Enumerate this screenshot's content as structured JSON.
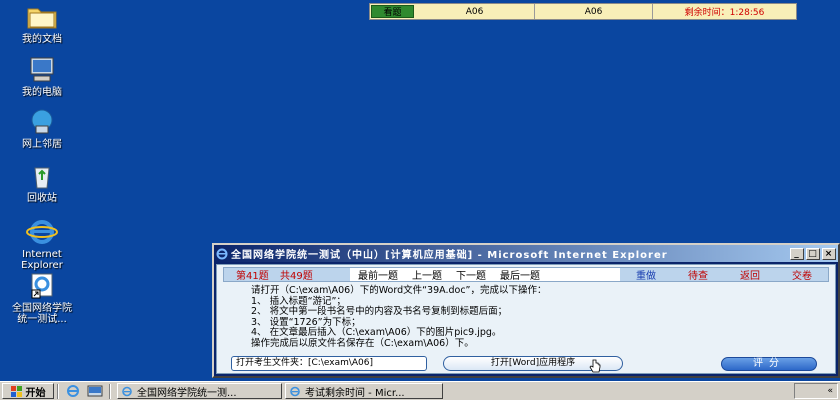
{
  "desktop": {
    "icons": [
      {
        "label": "我的文档",
        "icon": "folder-icon"
      },
      {
        "label": "我的电脑",
        "icon": "computer-icon"
      },
      {
        "label": "网上邻居",
        "icon": "network-icon"
      },
      {
        "label": "回收站",
        "icon": "recycle-bin-icon"
      },
      {
        "label": "Internet\nExplorer",
        "icon": "ie-icon"
      },
      {
        "label": "全国网络学院\n统一测试...",
        "icon": "shortcut-icon"
      }
    ]
  },
  "exam_bar": {
    "view_label": "看题",
    "field1": "A06",
    "field2": "A06",
    "timer": "剩余时间：1:28:56"
  },
  "window": {
    "title": "全国网络学院统一测试（中山）[计算机应用基础] - Microsoft Internet Explorer",
    "title_buttons": [
      "_",
      "□",
      "×"
    ],
    "nav": {
      "question_no": "第41题",
      "question_total": "共49题",
      "first": "最前一题",
      "prev": "上一题",
      "next": "下一题",
      "last": "最后一题",
      "redo": "重做",
      "pending": "待查",
      "back": "返回",
      "submit": "交卷"
    },
    "task_lines": [
      "请打开（C:\\exam\\A06）下的Word文件“39A.doc”，完成以下操作：",
      "1、 插入标题“游记”；",
      "2、 将文中第一段书名号中的内容及书名号复制到标题后面；",
      "3、 设置“1726”为下标；",
      "4、 在文章最后插入（C:\\exam\\A06）下的图片pic9.jpg。",
      "操作完成后以原文件名保存在（C:\\exam\\A06）下。"
    ],
    "open_folder_label": "打开考生文件夹：[C:\\exam\\A06]",
    "open_word_label": "打开[Word]应用程序",
    "score_label": "评分"
  },
  "taskbar": {
    "start_label": "开始",
    "tasks": [
      {
        "label": "全国网络学院统一测...",
        "icon": "ie-icon"
      },
      {
        "label": "考试剩余时间 - Micr...",
        "icon": "ie-icon"
      }
    ],
    "tray_text": "«"
  },
  "colors": {
    "desktop": "#0a46a0",
    "title_bar": "#0a246a",
    "timer": "#d00000",
    "accent_red": "#c00000",
    "view_button": "#2f8a2f"
  }
}
